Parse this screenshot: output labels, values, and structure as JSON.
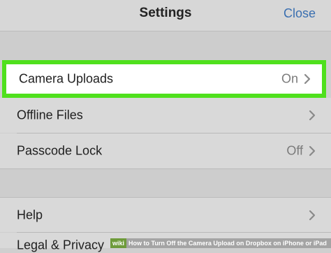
{
  "navbar": {
    "title": "Settings",
    "close_label": "Close"
  },
  "cells": {
    "camera_uploads": {
      "label": "Camera Uploads",
      "value": "On"
    },
    "offline_files": {
      "label": "Offline Files"
    },
    "passcode_lock": {
      "label": "Passcode Lock",
      "value": "Off"
    },
    "help": {
      "label": "Help"
    },
    "legal": {
      "label": "Legal & Privacy"
    }
  },
  "watermark": {
    "brand": "wiki",
    "text": "How to Turn Off the Camera Upload on Dropbox on iPhone or iPad"
  },
  "colors": {
    "accent": "#3a6fb0",
    "highlight_border": "#4fe01d",
    "cell_background": "#d9d9d9",
    "group_background": "#cdcdcd"
  },
  "icons": {
    "chevron": "chevron-right-icon"
  }
}
